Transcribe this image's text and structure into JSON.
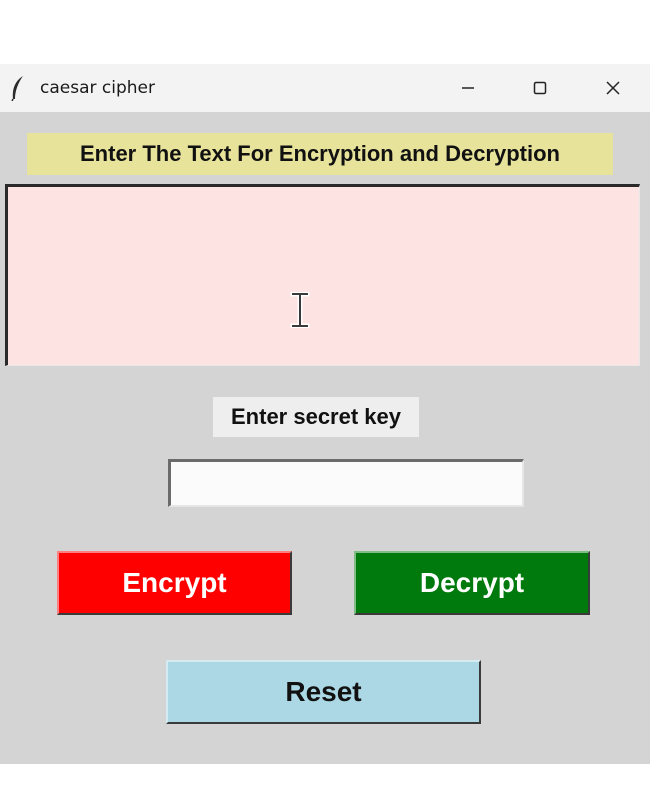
{
  "window": {
    "title": "caesar cipher",
    "icon": "feather-icon",
    "controls": [
      "minimize-icon",
      "maximize-icon",
      "close-icon"
    ]
  },
  "header": {
    "label": "Enter The Text For Encryption and Decryption"
  },
  "message_input": {
    "value": ""
  },
  "secret_key": {
    "label": "Enter secret key",
    "value": ""
  },
  "buttons": {
    "encrypt": "Encrypt",
    "decrypt": "Decrypt",
    "reset": "Reset"
  },
  "colors": {
    "header_bg": "#e8e39a",
    "text_area_bg": "#fde3e1",
    "encrypt_bg": "#ff0000",
    "decrypt_bg": "#007a0c",
    "reset_bg": "#acd8e6",
    "window_bg": "#d4d4d4"
  }
}
